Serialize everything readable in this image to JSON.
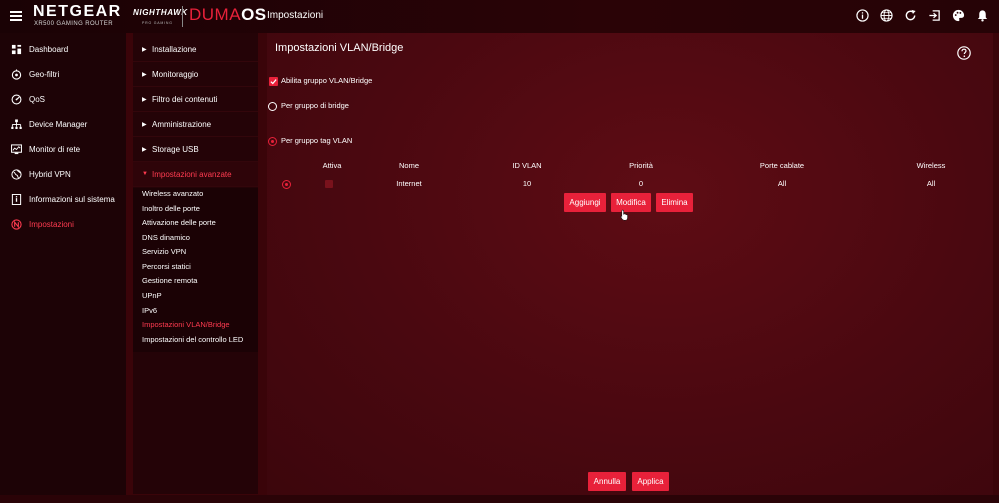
{
  "header": {
    "brand": "NETGEAR",
    "brand_sub": "XR500 GAMING ROUTER",
    "nighthawk": "NIGHTHAWK",
    "nighthawk_sub": "PRO GAMING",
    "os_part1": "DUMA",
    "os_part2": "OS",
    "page": "Impostazioni",
    "icons": [
      "info-icon",
      "globe-icon",
      "refresh-icon",
      "logout-icon",
      "palette-icon",
      "bell-icon"
    ]
  },
  "sidebar": {
    "items": [
      {
        "label": "Dashboard",
        "icon": "dashboard-icon"
      },
      {
        "label": "Geo-filtri",
        "icon": "geofilter-icon"
      },
      {
        "label": "QoS",
        "icon": "qos-icon"
      },
      {
        "label": "Device Manager",
        "icon": "device-manager-icon"
      },
      {
        "label": "Monitor di rete",
        "icon": "network-monitor-icon"
      },
      {
        "label": "Hybrid VPN",
        "icon": "vpn-icon"
      },
      {
        "label": "Informazioni sul sistema",
        "icon": "system-info-icon"
      },
      {
        "label": "Impostazioni",
        "icon": "settings-icon"
      }
    ]
  },
  "submenu": {
    "sections": [
      {
        "label": "Installazione"
      },
      {
        "label": "Monitoraggio"
      },
      {
        "label": "Filtro dei contenuti"
      },
      {
        "label": "Amministrazione"
      },
      {
        "label": "Storage USB"
      },
      {
        "label": "Impostazioni avanzate"
      }
    ],
    "advanced": [
      "Wireless avanzato",
      "Inoltro delle porte",
      "Attivazione delle porte",
      "DNS dinamico",
      "Servizio VPN",
      "Percorsi statici",
      "Gestione remota",
      "UPnP",
      "IPv6",
      "Impostazioni VLAN/Bridge",
      "Impostazioni del controllo LED"
    ]
  },
  "main": {
    "title": "Impostazioni VLAN/Bridge",
    "enable_label": "Abilita gruppo VLAN/Bridge",
    "bridge_label": "Per gruppo di bridge",
    "vlan_label": "Per gruppo tag VLAN",
    "table": {
      "headers": [
        "Attiva",
        "Nome",
        "ID VLAN",
        "Priorità",
        "Porte cablate",
        "Wireless"
      ],
      "row": {
        "name": "Internet",
        "vlan_id": "10",
        "priority": "0",
        "wired": "All",
        "wireless": "All"
      }
    },
    "buttons": {
      "add": "Aggiungi",
      "edit": "Modifica",
      "delete": "Elimina"
    },
    "footer": {
      "cancel": "Annulla",
      "apply": "Applica"
    }
  },
  "colors": {
    "accent": "#e8213a",
    "bg": "#3a0409",
    "panel": "#4a0810"
  }
}
